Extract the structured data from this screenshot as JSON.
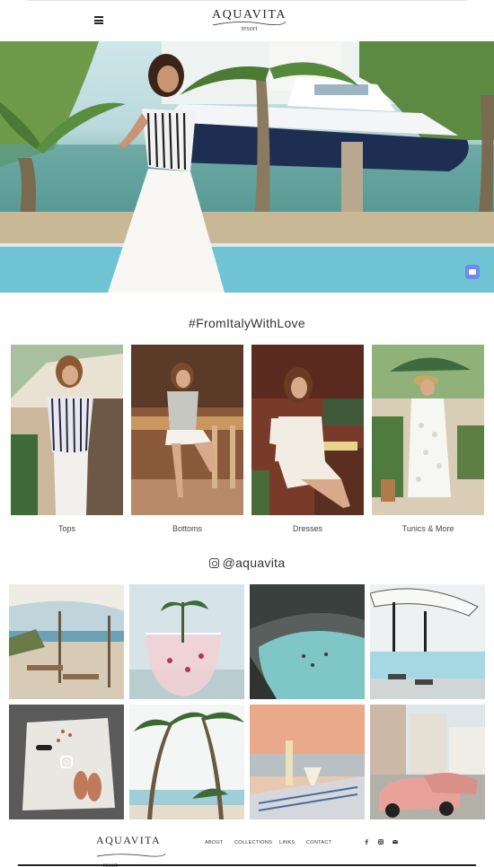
{
  "header": {
    "logo_main": "AQUAVITA",
    "logo_sub": "resort"
  },
  "collections": {
    "title": "#FromItalyWithLove",
    "items": [
      {
        "label": "Tops"
      },
      {
        "label": "Bottoms"
      },
      {
        "label": "Dresses"
      },
      {
        "label": "Tunics & More"
      }
    ]
  },
  "instagram": {
    "handle": "@aquavita",
    "grid_count": 8
  },
  "footer": {
    "logo_main": "AQUAVITA",
    "logo_sub": "resort",
    "nav": [
      "ABOUT",
      "COLLECTIONS",
      "LINKS",
      "CONTACT"
    ],
    "social": [
      "facebook-icon",
      "instagram-icon",
      "email-icon"
    ]
  },
  "colors": {
    "accent_chat": "#6d8cf0",
    "text": "#333333"
  }
}
